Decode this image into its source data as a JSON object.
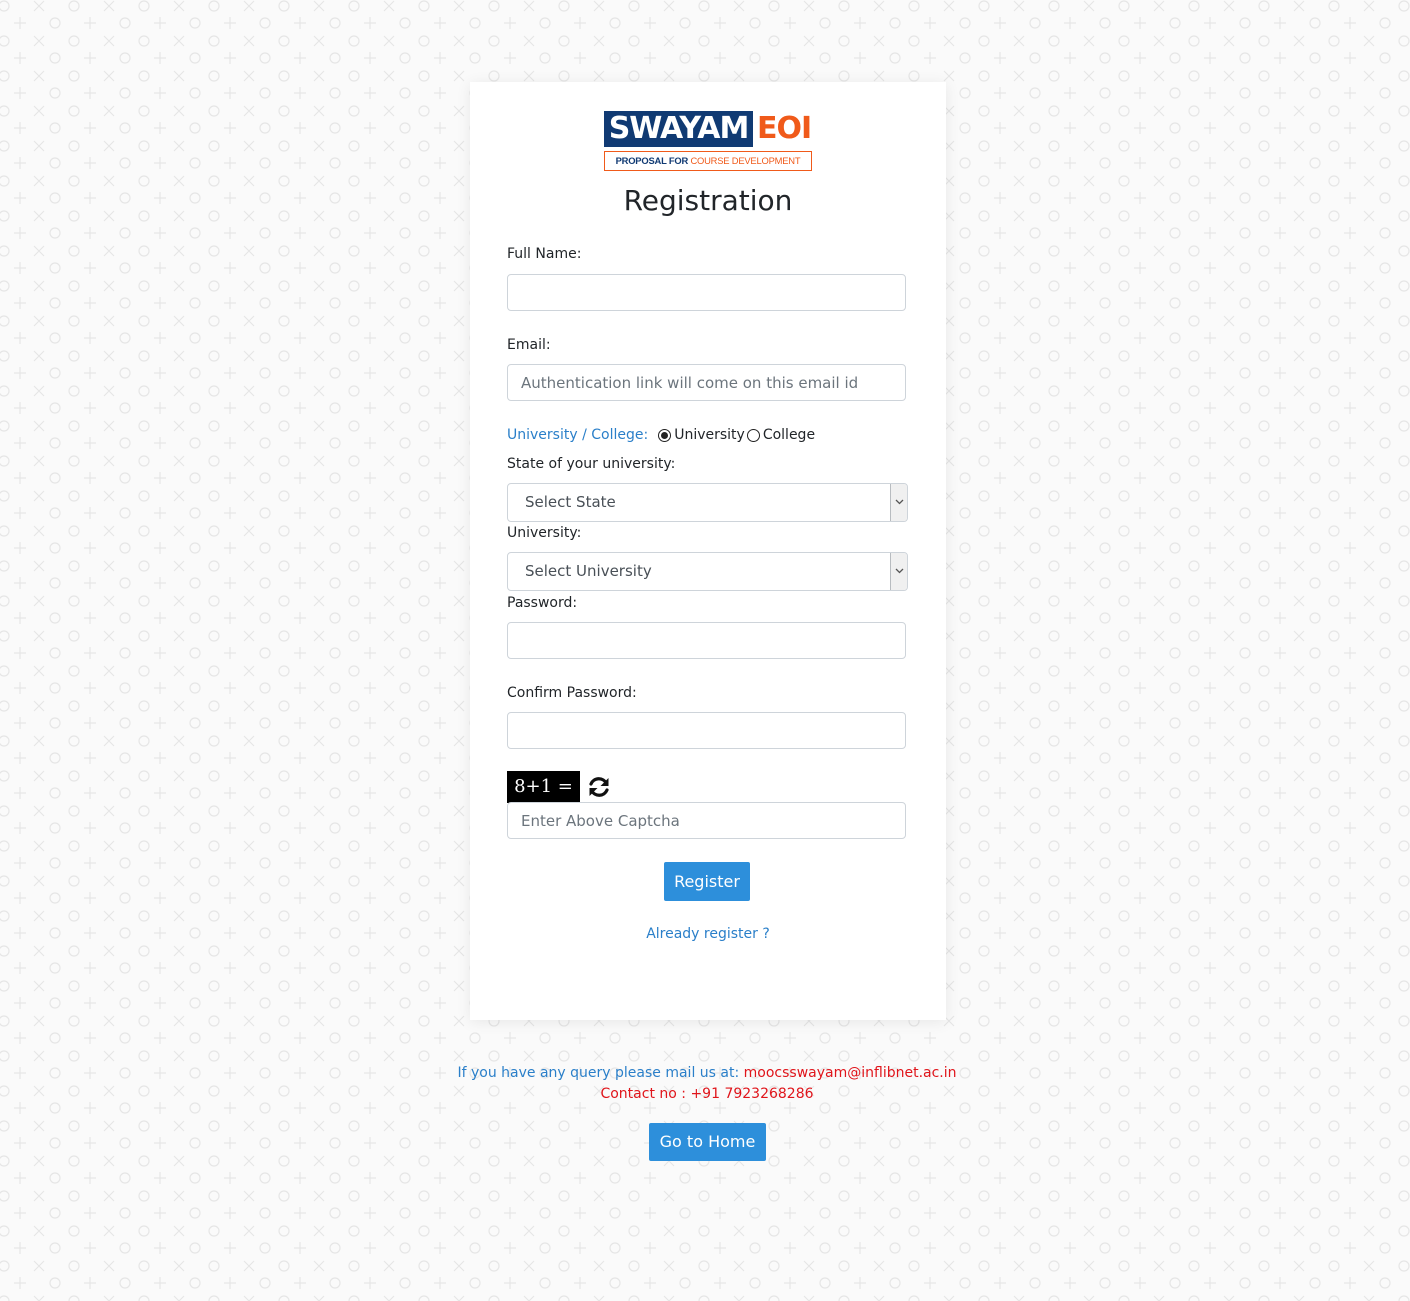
{
  "logo": {
    "brand": "SWAYAM",
    "suffix": "EOI",
    "tagline_part1": "PROPOSAL FOR",
    "tagline_part2": "COURSE DEVELOPMENT"
  },
  "title": "Registration",
  "form": {
    "full_name_label": "Full Name:",
    "full_name_value": "",
    "email_label": "Email:",
    "email_placeholder": "Authentication link will come on this email id",
    "type_label": "University / College:",
    "type_options": [
      "University",
      "College"
    ],
    "type_selected": "University",
    "state_label": "State of your university:",
    "state_value": "Select State",
    "university_label": "University:",
    "university_value": "Select University",
    "password_label": "Password:",
    "confirm_password_label": "Confirm Password:",
    "captcha_text": "8+1 = ?",
    "captcha_placeholder": "Enter Above Captcha",
    "register_label": "Register",
    "already_link": "Already register ?"
  },
  "footer": {
    "query_text": "If you have any query please mail us at: ",
    "email": "moocsswayam@inflibnet.ac.in",
    "contact": "Contact no : +91 7923268286",
    "home_button": "Go to Home"
  },
  "colors": {
    "brand_navy": "#103a73",
    "brand_orange": "#f05a1a",
    "button_blue": "#2d8fdb",
    "link_blue": "#2a7fc9",
    "alert_red": "#e0151b"
  },
  "icons": {
    "refresh": "refresh-icon",
    "select_arrow": "chevron-down-icon"
  }
}
